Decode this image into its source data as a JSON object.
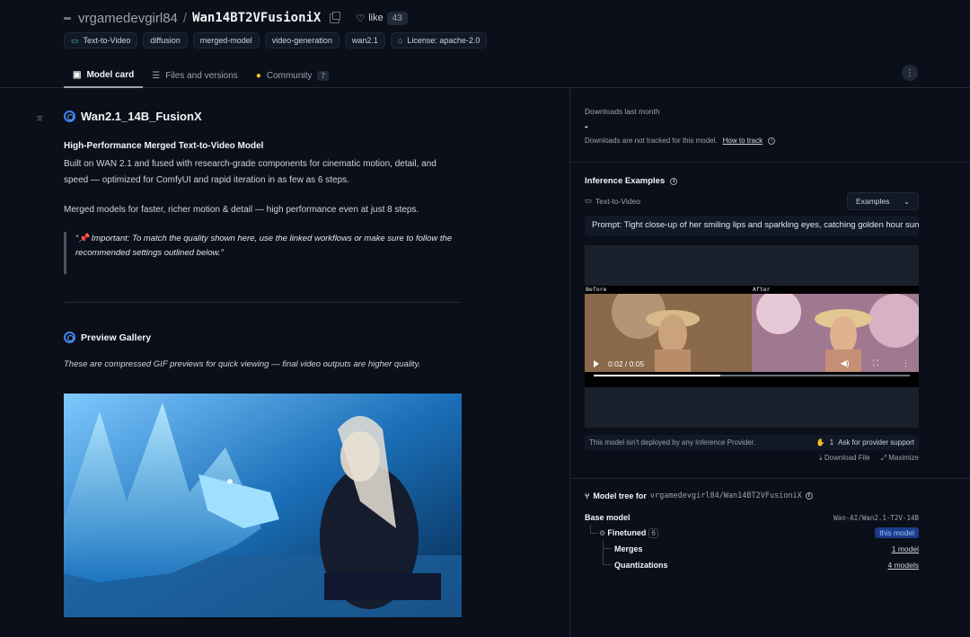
{
  "header": {
    "owner": "vrgamedevgirl84",
    "separator": "/",
    "repo": "Wan14BT2VFusioniX",
    "like_label": "like",
    "like_count": "43",
    "tags": [
      {
        "label": "Text-to-Video",
        "icon": "video-icon"
      },
      {
        "label": "diffusion"
      },
      {
        "label": "merged-model"
      },
      {
        "label": "video-generation"
      },
      {
        "label": "wan2.1"
      },
      {
        "label": "License: apache-2.0",
        "icon": "license-icon"
      }
    ],
    "tabs": [
      {
        "label": "Model card",
        "icon": "cube-icon",
        "active": true
      },
      {
        "label": "Files and versions",
        "icon": "files-icon"
      },
      {
        "label": "Community",
        "icon": "community-icon",
        "badge": "7"
      }
    ],
    "more": "⋮"
  },
  "card": {
    "toc": "≡",
    "title": "Wan2.1_14B_FusionX",
    "subtitle": "High-Performance Merged Text-to-Video Model",
    "intro": "Built on WAN 2.1 and fused with research-grade components for cinematic motion, detail, and speed — optimized for ComfyUI and rapid iteration in as few as 6 steps.",
    "merged_note": "Merged models for faster, richer motion & detail — high performance even at just 8 steps.",
    "important": "“📌 Important: To match the quality shown here, use the linked workflows or make sure to follow the recommended settings outlined below.”",
    "gallery_title": "Preview Gallery",
    "gallery_note": "These are compressed GIF previews for quick viewing — final video outputs are higher quality."
  },
  "sidebar": {
    "downloads_label": "Downloads last month",
    "downloads_value": "-",
    "downloads_note": "Downloads are not tracked for this model.",
    "how_to_track": "How to track",
    "inference_title": "Inference Examples",
    "task": "Text-to-Video",
    "examples_btn": "Examples",
    "prompt": "Prompt: Tight close-up of her smiling lips and sparkling eyes, catching golden hour sunlight",
    "video": {
      "before_label": "Before",
      "after_label": "After",
      "time": "0:02 / 0:05",
      "progress": 0.4
    },
    "not_deployed": "This model isn't deployed by any Inference Provider.",
    "ask_count": "1",
    "ask_label": "Ask for provider support",
    "download_file": "Download File",
    "maximize": "Maximize",
    "tree_title": "Model tree for",
    "tree_repo": "vrgamedevgirl84/Wan14BT2VFusioniX",
    "base_model_label": "Base model",
    "base_model_value": "Wan-AI/Wan2.1-T2V-14B",
    "finetuned_label": "Finetuned",
    "finetuned_count": "6",
    "this_model": "this model",
    "merges_label": "Merges",
    "merges_value": "1 model",
    "quant_label": "Quantizations",
    "quant_value": "4 models"
  },
  "colors": {
    "background": "#0b0f19",
    "accent": "#3b82f6",
    "text": "#d1d5db"
  }
}
